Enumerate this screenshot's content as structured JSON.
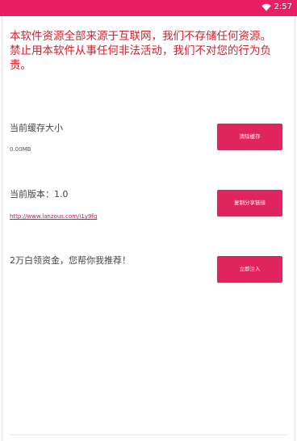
{
  "status_bar": {
    "time": "2:57",
    "color": "#e91e63",
    "icons": [
      "wifi-icon"
    ]
  },
  "notice": {
    "line1": "本软件资源全部来源于互联网，我们不存储任何资源。",
    "line2": "禁止用本软件从事任何非法活动，我们不对您的行为负责。",
    "color": "#d21f2c"
  },
  "cache": {
    "label": "当前缓存大小",
    "value": "0.00MB",
    "button_label": "清除缓存"
  },
  "version": {
    "label": "当前版本：1.0",
    "link": "http://www.lanzous.com/i1y9fg",
    "button_label": "复制分享链接"
  },
  "donate": {
    "label": "2万白领资金，您帮你我推荐！",
    "button_label": "立即注入"
  },
  "accent_color": "#e0245e"
}
